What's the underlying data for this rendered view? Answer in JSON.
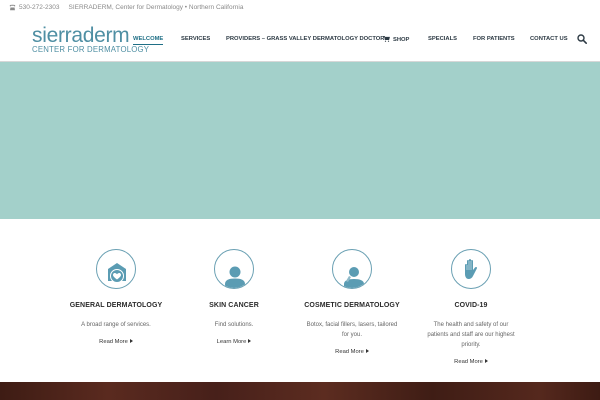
{
  "topbar": {
    "phone": "530-272-2303",
    "tagline": "SIERRADERM, Center for Dermatology • Northern California"
  },
  "logo": {
    "name": "sierraderm",
    "sub": "CENTER FOR DERMATOLOGY"
  },
  "nav": {
    "items": [
      {
        "label": "WELCOME",
        "active": true
      },
      {
        "label": "SERVICES"
      },
      {
        "label": "PROVIDERS – GRASS VALLEY DERMATOLOGY DOCTOR"
      },
      {
        "label": "SHOP",
        "icon": "cart-icon"
      },
      {
        "label": "SPECIALS"
      },
      {
        "label": "FOR PATIENTS"
      },
      {
        "label": "CONTACT US"
      }
    ],
    "search_icon": "search-icon"
  },
  "hero": {
    "color": "#a3d0ca"
  },
  "features": [
    {
      "icon": "heart-icon",
      "title": "GENERAL DERMATOLOGY",
      "desc": "A broad range of services.",
      "more": "Read More"
    },
    {
      "icon": "person-icon",
      "title": "SKIN CANCER",
      "desc": "Find solutions.",
      "more": "Learn More"
    },
    {
      "icon": "face-treatment-icon",
      "title": "COSMETIC DERMATOLOGY",
      "desc": "Botox, facial fillers, lasers, tailored for you.",
      "more": "Read More"
    },
    {
      "icon": "hand-stop-icon",
      "title": "COVID-19",
      "desc": "The health and safety of our patients and staff are our highest priority.",
      "more": "Read More"
    }
  ],
  "colors": {
    "brand": "#4f8fa3",
    "icon": "#5b9cb3",
    "footer": "#4a2219"
  }
}
